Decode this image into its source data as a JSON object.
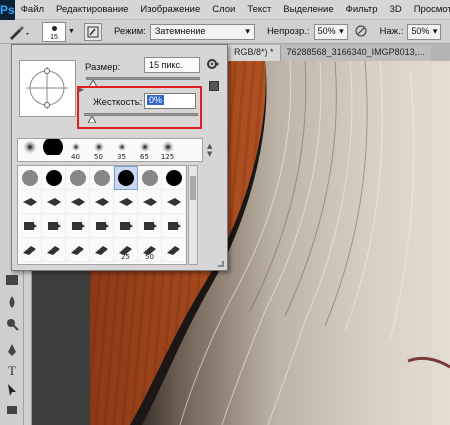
{
  "app": {
    "logo": "Ps"
  },
  "menu": [
    "Файл",
    "Редактирование",
    "Изображение",
    "Слои",
    "Текст",
    "Выделение",
    "Фильтр",
    "3D",
    "Просмотр"
  ],
  "options_bar": {
    "preset_size": "15",
    "mode_label": "Режим:",
    "mode_value": "Затемнение",
    "opacity_label": "Непрозр.:",
    "opacity_value": "50%",
    "pressure_label": "Наж.:",
    "pressure_value": "50%"
  },
  "tabs": [
    {
      "label": "RGB/8*) *"
    },
    {
      "label": "76288568_3166340_IMGP8013,..."
    }
  ],
  "brush_panel": {
    "size_label": "Размер:",
    "size_value": "15 пикс.",
    "hardness_label": "Жесткость:",
    "hardness_value": "0%",
    "size_level": 0.06,
    "hardness_level": 0.0,
    "recent": [
      {
        "num": ""
      },
      {
        "num": ""
      },
      {
        "num": "40"
      },
      {
        "num": "50"
      },
      {
        "num": "35"
      },
      {
        "num": "65"
      },
      {
        "num": "125"
      }
    ],
    "grid_numbers": {
      "r4c5": "25",
      "r4c6": "50"
    }
  }
}
